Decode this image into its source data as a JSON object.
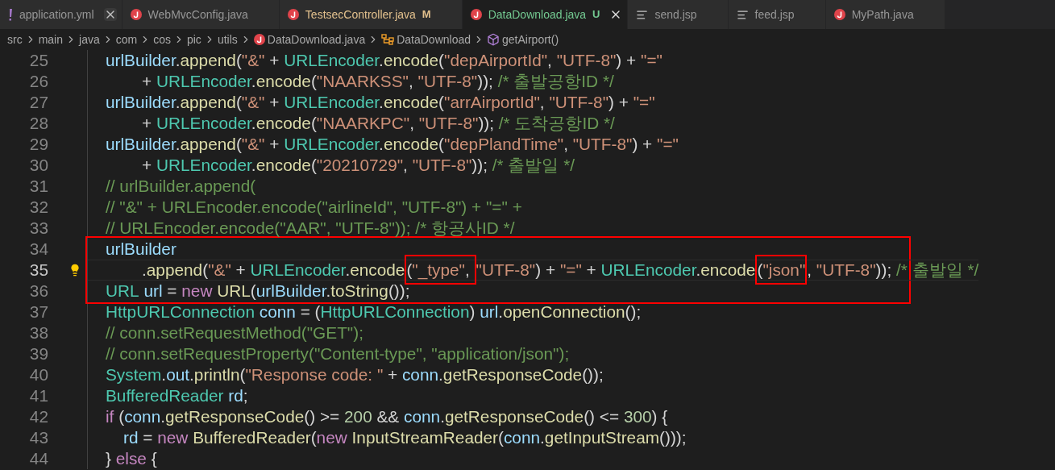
{
  "tabs": [
    {
      "label": "application.yml",
      "kind": "yaml",
      "color": "#969696",
      "close_button": true,
      "selected": false
    },
    {
      "label": "WebMvcConfig.java",
      "kind": "java",
      "color": "#969696",
      "close_button": false,
      "selected": false
    },
    {
      "label": "TestsecController.java",
      "kind": "java",
      "color": "#e2c08d",
      "badge": "M",
      "close_button": false,
      "selected": false
    },
    {
      "label": "DataDownload.java",
      "kind": "java",
      "color": "#73c991",
      "badge": "U",
      "close_button": true,
      "selected": true
    },
    {
      "label": "send.jsp",
      "kind": "lines",
      "color": "#969696",
      "close_button": false,
      "selected": false
    },
    {
      "label": "feed.jsp",
      "kind": "lines",
      "color": "#969696",
      "close_button": false,
      "selected": false
    },
    {
      "label": "MyPath.java",
      "kind": "java",
      "color": "#969696",
      "close_button": false,
      "selected": false
    }
  ],
  "breadcrumb": [
    {
      "label": "src",
      "kind": "folder"
    },
    {
      "label": "main",
      "kind": "folder"
    },
    {
      "label": "java",
      "kind": "folder"
    },
    {
      "label": "com",
      "kind": "folder"
    },
    {
      "label": "cos",
      "kind": "folder"
    },
    {
      "label": "pic",
      "kind": "folder"
    },
    {
      "label": "utils",
      "kind": "folder"
    },
    {
      "label": "DataDownload.java",
      "kind": "java"
    },
    {
      "label": "DataDownload",
      "kind": "class"
    },
    {
      "label": "getAirport()",
      "kind": "method"
    }
  ],
  "lines": [
    {
      "number": "25",
      "kind": "block",
      "active": false,
      "boxed": false,
      "tokens": [
        {
          "text": "urlBuilder",
          "kind": "var"
        },
        {
          "text": ".",
          "kind": "plain"
        },
        {
          "text": "append",
          "kind": "func"
        },
        {
          "text": "(",
          "kind": "plain"
        },
        {
          "text": "\"&\"",
          "kind": "str"
        },
        {
          "text": " + ",
          "kind": "plain"
        },
        {
          "text": "URLEncoder",
          "kind": "type"
        },
        {
          "text": ".",
          "kind": "plain"
        },
        {
          "text": "encode",
          "kind": "func"
        },
        {
          "text": "(",
          "kind": "plain"
        },
        {
          "text": "\"depAirportId\"",
          "kind": "str"
        },
        {
          "text": ", ",
          "kind": "plain"
        },
        {
          "text": "\"UTF-8\"",
          "kind": "str"
        },
        {
          "text": ") + ",
          "kind": "plain"
        },
        {
          "text": "\"=\"",
          "kind": "str"
        }
      ]
    },
    {
      "number": "26",
      "kind": "continuation",
      "active": false,
      "boxed": false,
      "tokens": [
        {
          "text": "+ ",
          "kind": "plain"
        },
        {
          "text": "URLEncoder",
          "kind": "type"
        },
        {
          "text": ".",
          "kind": "plain"
        },
        {
          "text": "encode",
          "kind": "func"
        },
        {
          "text": "(",
          "kind": "plain"
        },
        {
          "text": "\"NAARKSS\"",
          "kind": "str"
        },
        {
          "text": ", ",
          "kind": "plain"
        },
        {
          "text": "\"UTF-8\"",
          "kind": "str"
        },
        {
          "text": ")); ",
          "kind": "plain"
        },
        {
          "text": "/* 출발공항ID */",
          "kind": "comment"
        }
      ]
    },
    {
      "number": "27",
      "kind": "block",
      "active": false,
      "boxed": false,
      "tokens": [
        {
          "text": "urlBuilder",
          "kind": "var"
        },
        {
          "text": ".",
          "kind": "plain"
        },
        {
          "text": "append",
          "kind": "func"
        },
        {
          "text": "(",
          "kind": "plain"
        },
        {
          "text": "\"&\"",
          "kind": "str"
        },
        {
          "text": " + ",
          "kind": "plain"
        },
        {
          "text": "URLEncoder",
          "kind": "type"
        },
        {
          "text": ".",
          "kind": "plain"
        },
        {
          "text": "encode",
          "kind": "func"
        },
        {
          "text": "(",
          "kind": "plain"
        },
        {
          "text": "\"arrAirportId\"",
          "kind": "str"
        },
        {
          "text": ", ",
          "kind": "plain"
        },
        {
          "text": "\"UTF-8\"",
          "kind": "str"
        },
        {
          "text": ") + ",
          "kind": "plain"
        },
        {
          "text": "\"=\"",
          "kind": "str"
        }
      ]
    },
    {
      "number": "28",
      "kind": "continuation",
      "active": false,
      "boxed": false,
      "tokens": [
        {
          "text": "+ ",
          "kind": "plain"
        },
        {
          "text": "URLEncoder",
          "kind": "type"
        },
        {
          "text": ".",
          "kind": "plain"
        },
        {
          "text": "encode",
          "kind": "func"
        },
        {
          "text": "(",
          "kind": "plain"
        },
        {
          "text": "\"NAARKPC\"",
          "kind": "str"
        },
        {
          "text": ", ",
          "kind": "plain"
        },
        {
          "text": "\"UTF-8\"",
          "kind": "str"
        },
        {
          "text": ")); ",
          "kind": "plain"
        },
        {
          "text": "/* 도착공항ID */",
          "kind": "comment"
        }
      ]
    },
    {
      "number": "29",
      "kind": "block",
      "active": false,
      "boxed": false,
      "tokens": [
        {
          "text": "urlBuilder",
          "kind": "var"
        },
        {
          "text": ".",
          "kind": "plain"
        },
        {
          "text": "append",
          "kind": "func"
        },
        {
          "text": "(",
          "kind": "plain"
        },
        {
          "text": "\"&\"",
          "kind": "str"
        },
        {
          "text": " + ",
          "kind": "plain"
        },
        {
          "text": "URLEncoder",
          "kind": "type"
        },
        {
          "text": ".",
          "kind": "plain"
        },
        {
          "text": "encode",
          "kind": "func"
        },
        {
          "text": "(",
          "kind": "plain"
        },
        {
          "text": "\"depPlandTime\"",
          "kind": "str"
        },
        {
          "text": ", ",
          "kind": "plain"
        },
        {
          "text": "\"UTF-8\"",
          "kind": "str"
        },
        {
          "text": ") + ",
          "kind": "plain"
        },
        {
          "text": "\"=\"",
          "kind": "str"
        }
      ]
    },
    {
      "number": "30",
      "kind": "continuation",
      "active": false,
      "boxed": false,
      "tokens": [
        {
          "text": "+ ",
          "kind": "plain"
        },
        {
          "text": "URLEncoder",
          "kind": "type"
        },
        {
          "text": ".",
          "kind": "plain"
        },
        {
          "text": "encode",
          "kind": "func"
        },
        {
          "text": "(",
          "kind": "plain"
        },
        {
          "text": "\"20210729\"",
          "kind": "str"
        },
        {
          "text": ", ",
          "kind": "plain"
        },
        {
          "text": "\"UTF-8\"",
          "kind": "str"
        },
        {
          "text": ")); ",
          "kind": "plain"
        },
        {
          "text": "/* 출발일 */",
          "kind": "comment"
        }
      ]
    },
    {
      "number": "31",
      "kind": "block",
      "active": false,
      "boxed": false,
      "tokens": [
        {
          "text": "// urlBuilder.append(",
          "kind": "comment"
        }
      ]
    },
    {
      "number": "32",
      "kind": "block",
      "active": false,
      "boxed": false,
      "tokens": [
        {
          "text": "// \"&\" + URLEncoder.encode(\"airlineId\", \"UTF-8\") + \"=\" +",
          "kind": "comment"
        }
      ]
    },
    {
      "number": "33",
      "kind": "block",
      "active": false,
      "boxed": false,
      "tokens": [
        {
          "text": "// URLEncoder.encode(\"AAR\", \"UTF-8\")); /* 항공사ID */",
          "kind": "comment"
        }
      ]
    },
    {
      "number": "34",
      "kind": "block",
      "active": false,
      "boxed": true,
      "tokens": [
        {
          "text": "urlBuilder",
          "kind": "var"
        }
      ]
    },
    {
      "number": "35",
      "kind": "continuation",
      "active": true,
      "boxed": true,
      "tokens": [
        {
          "text": ".",
          "kind": "plain"
        },
        {
          "text": "append",
          "kind": "func"
        },
        {
          "text": "(",
          "kind": "plain"
        },
        {
          "text": "\"&\"",
          "kind": "str"
        },
        {
          "text": " + ",
          "kind": "plain"
        },
        {
          "text": "URLEncoder",
          "kind": "type"
        },
        {
          "text": ".",
          "kind": "plain"
        },
        {
          "text": "encode",
          "kind": "func"
        },
        {
          "kind": "box",
          "tokens": [
            {
              "text": "(",
              "kind": "plain"
            },
            {
              "text": "\"_type\"",
              "kind": "str"
            },
            {
              "text": ", ",
              "kind": "plain"
            }
          ]
        },
        {
          "text": "\"UTF-8\"",
          "kind": "str"
        },
        {
          "text": ")",
          "kind": "plain"
        },
        {
          "text": " + ",
          "kind": "plain"
        },
        {
          "text": "\"=\"",
          "kind": "str"
        },
        {
          "text": " + ",
          "kind": "plain"
        },
        {
          "text": "URLEncoder",
          "kind": "type"
        },
        {
          "text": ".",
          "kind": "plain"
        },
        {
          "text": "encode",
          "kind": "func"
        },
        {
          "kind": "box",
          "tokens": [
            {
              "text": "(",
              "kind": "plain"
            },
            {
              "text": "\"json\"",
              "kind": "str"
            }
          ]
        },
        {
          "text": ", ",
          "kind": "plain"
        },
        {
          "text": "\"UTF-8\"",
          "kind": "str"
        },
        {
          "text": ")); ",
          "kind": "plain"
        },
        {
          "text": "/* 출발일 */",
          "kind": "comment"
        }
      ]
    },
    {
      "number": "36",
      "kind": "block",
      "active": false,
      "boxed": true,
      "tokens": [
        {
          "text": "URL",
          "kind": "type"
        },
        {
          "kind": "space"
        },
        {
          "text": "url",
          "kind": "var"
        },
        {
          "text": " = ",
          "kind": "plain"
        },
        {
          "text": "new",
          "kind": "kw"
        },
        {
          "kind": "space"
        },
        {
          "text": "URL",
          "kind": "func"
        },
        {
          "text": "(",
          "kind": "plain"
        },
        {
          "text": "urlBuilder",
          "kind": "var"
        },
        {
          "text": ".",
          "kind": "plain"
        },
        {
          "text": "toString",
          "kind": "func"
        },
        {
          "text": "());",
          "kind": "plain"
        }
      ]
    },
    {
      "number": "37",
      "kind": "block",
      "active": false,
      "boxed": false,
      "tokens": [
        {
          "text": "HttpURLConnection",
          "kind": "type"
        },
        {
          "kind": "space"
        },
        {
          "text": "conn",
          "kind": "var"
        },
        {
          "text": " = (",
          "kind": "plain"
        },
        {
          "text": "HttpURLConnection",
          "kind": "type"
        },
        {
          "text": ") ",
          "kind": "plain"
        },
        {
          "text": "url",
          "kind": "var"
        },
        {
          "text": ".",
          "kind": "plain"
        },
        {
          "text": "openConnection",
          "kind": "func"
        },
        {
          "text": "();",
          "kind": "plain"
        }
      ]
    },
    {
      "number": "38",
      "kind": "block",
      "active": false,
      "boxed": false,
      "tokens": [
        {
          "text": "// conn.setRequestMethod(\"GET\");",
          "kind": "comment"
        }
      ]
    },
    {
      "number": "39",
      "kind": "block",
      "active": false,
      "boxed": false,
      "tokens": [
        {
          "text": "// conn.setRequestProperty(\"Content-type\", \"application/json\");",
          "kind": "comment"
        }
      ]
    },
    {
      "number": "40",
      "kind": "block",
      "active": false,
      "boxed": false,
      "tokens": [
        {
          "text": "System",
          "kind": "type"
        },
        {
          "text": ".",
          "kind": "plain"
        },
        {
          "text": "out",
          "kind": "var"
        },
        {
          "text": ".",
          "kind": "plain"
        },
        {
          "text": "println",
          "kind": "func"
        },
        {
          "text": "(",
          "kind": "plain"
        },
        {
          "text": "\"Response code: \"",
          "kind": "str"
        },
        {
          "text": " + ",
          "kind": "plain"
        },
        {
          "text": "conn",
          "kind": "var"
        },
        {
          "text": ".",
          "kind": "plain"
        },
        {
          "text": "getResponseCode",
          "kind": "func"
        },
        {
          "text": "());",
          "kind": "plain"
        }
      ]
    },
    {
      "number": "41",
      "kind": "block",
      "active": false,
      "boxed": false,
      "tokens": [
        {
          "text": "BufferedReader",
          "kind": "type"
        },
        {
          "kind": "space"
        },
        {
          "text": "rd",
          "kind": "var"
        },
        {
          "text": ";",
          "kind": "plain"
        }
      ]
    },
    {
      "number": "42",
      "kind": "block",
      "active": false,
      "boxed": false,
      "tokens": [
        {
          "text": "if",
          "kind": "kw"
        },
        {
          "text": " (",
          "kind": "plain"
        },
        {
          "text": "conn",
          "kind": "var"
        },
        {
          "text": ".",
          "kind": "plain"
        },
        {
          "text": "getResponseCode",
          "kind": "func"
        },
        {
          "text": "() >= ",
          "kind": "plain"
        },
        {
          "text": "200",
          "kind": "num"
        },
        {
          "text": " && ",
          "kind": "plain"
        },
        {
          "text": "conn",
          "kind": "var"
        },
        {
          "text": ".",
          "kind": "plain"
        },
        {
          "text": "getResponseCode",
          "kind": "func"
        },
        {
          "text": "() <= ",
          "kind": "plain"
        },
        {
          "text": "300",
          "kind": "num"
        },
        {
          "text": ") {",
          "kind": "plain"
        }
      ]
    },
    {
      "number": "43",
      "kind": "nested",
      "active": false,
      "boxed": false,
      "tokens": [
        {
          "text": "rd",
          "kind": "var"
        },
        {
          "text": " = ",
          "kind": "plain"
        },
        {
          "text": "new",
          "kind": "kw"
        },
        {
          "kind": "space"
        },
        {
          "text": "BufferedReader",
          "kind": "func"
        },
        {
          "text": "(",
          "kind": "plain"
        },
        {
          "text": "new",
          "kind": "kw"
        },
        {
          "kind": "space"
        },
        {
          "text": "InputStreamReader",
          "kind": "func"
        },
        {
          "text": "(",
          "kind": "plain"
        },
        {
          "text": "conn",
          "kind": "var"
        },
        {
          "text": ".",
          "kind": "plain"
        },
        {
          "text": "getInputStream",
          "kind": "func"
        },
        {
          "text": "()));",
          "kind": "plain"
        }
      ]
    },
    {
      "number": "44",
      "kind": "block",
      "active": false,
      "boxed": false,
      "tokens": [
        {
          "text": "} ",
          "kind": "plain"
        },
        {
          "text": "else",
          "kind": "kw"
        },
        {
          "text": " {",
          "kind": "plain"
        }
      ]
    }
  ]
}
